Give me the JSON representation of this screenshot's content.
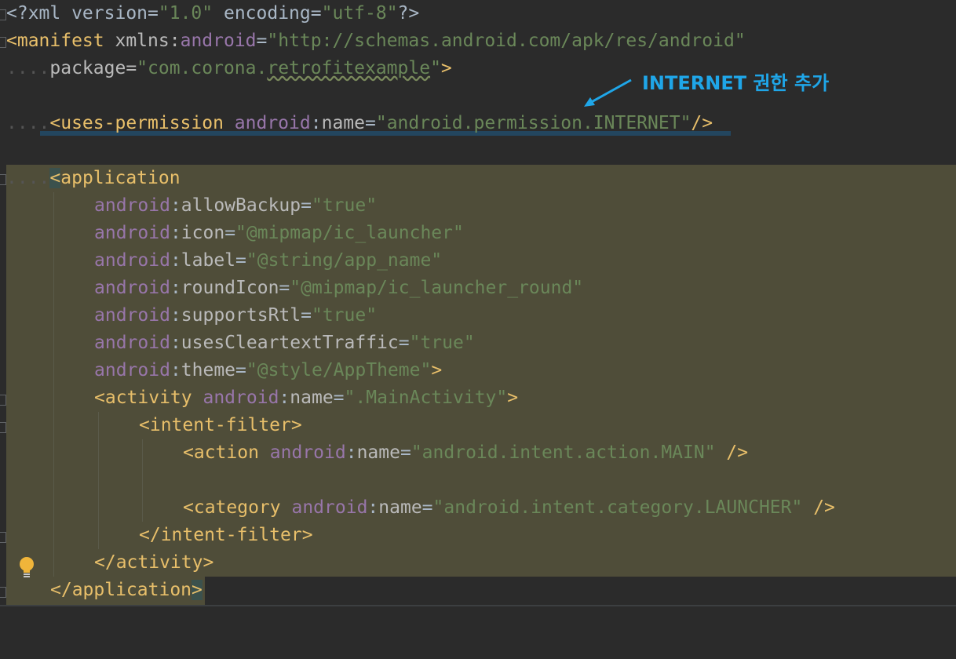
{
  "editor": {
    "line1": {
      "a": "<?xml version=",
      "b": "\"1.0\"",
      "c": " encoding=",
      "d": "\"utf-8\"",
      "e": "?>"
    },
    "line2": {
      "a": "<manifest ",
      "ns": "xmlns",
      "colon": ":",
      "attr": "android",
      "eq": "=",
      "val": "\"http://schemas.android.com/apk/res/android\""
    },
    "line3": {
      "a": "package=",
      "q1": "\"com.corona.",
      "sq": "retrofitexample",
      "q2": "\"",
      "end": ">"
    },
    "line5": {
      "tag": "<uses-permission ",
      "ns": "android",
      "colon": ":",
      "attr": "name",
      "eq": "=",
      "val": "\"android.permission.INTERNET\"",
      "end": "/>"
    },
    "line7": {
      "lt": "<",
      "tag": "application"
    },
    "attrs": [
      {
        "ns": "android",
        "name": "allowBackup",
        "val": "\"true\"",
        "end": ""
      },
      {
        "ns": "android",
        "name": "icon",
        "val": "\"@mipmap/ic_launcher\"",
        "end": ""
      },
      {
        "ns": "android",
        "name": "label",
        "val": "\"@string/app_name\"",
        "end": ""
      },
      {
        "ns": "android",
        "name": "roundIcon",
        "val": "\"@mipmap/ic_launcher_round\"",
        "end": ""
      },
      {
        "ns": "android",
        "name": "supportsRtl",
        "val": "\"true\"",
        "end": ""
      },
      {
        "ns": "android",
        "name": "usesCleartextTraffic",
        "val": "\"true\"",
        "end": ""
      },
      {
        "ns": "android",
        "name": "theme",
        "val": "\"@style/AppTheme\"",
        "end": ">"
      }
    ],
    "activity": {
      "tag": "<activity ",
      "ns": "android",
      "colon": ":",
      "attr": "name",
      "eq": "=",
      "val": "\".MainActivity\"",
      "end": ">"
    },
    "intent_open": "<intent-filter>",
    "action": {
      "tag": "<action ",
      "ns": "android",
      "colon": ":",
      "attr": "name",
      "eq": "=",
      "val": "\"android.intent.action.MAIN\"",
      "end": " />"
    },
    "category": {
      "tag": "<category ",
      "ns": "android",
      "colon": ":",
      "attr": "name",
      "eq": "=",
      "val": "\"android.intent.category.LAUNCHER\"",
      "end": " />"
    },
    "intent_close": "</intent-filter>",
    "activity_close": "</activity>",
    "app_close": {
      "a": "</application",
      "b": ">"
    }
  },
  "annotation": {
    "text": "INTERNET 권한 추가",
    "color": "#1fa6e8"
  },
  "colors": {
    "background": "#2b2b2b",
    "highlight": "#4f4d39",
    "tag": "#e8bf6a",
    "namespace": "#9876aa",
    "value": "#6a8759"
  },
  "icons": {
    "bulb": "lightbulb-icon",
    "arrow": "arrow-icon"
  }
}
